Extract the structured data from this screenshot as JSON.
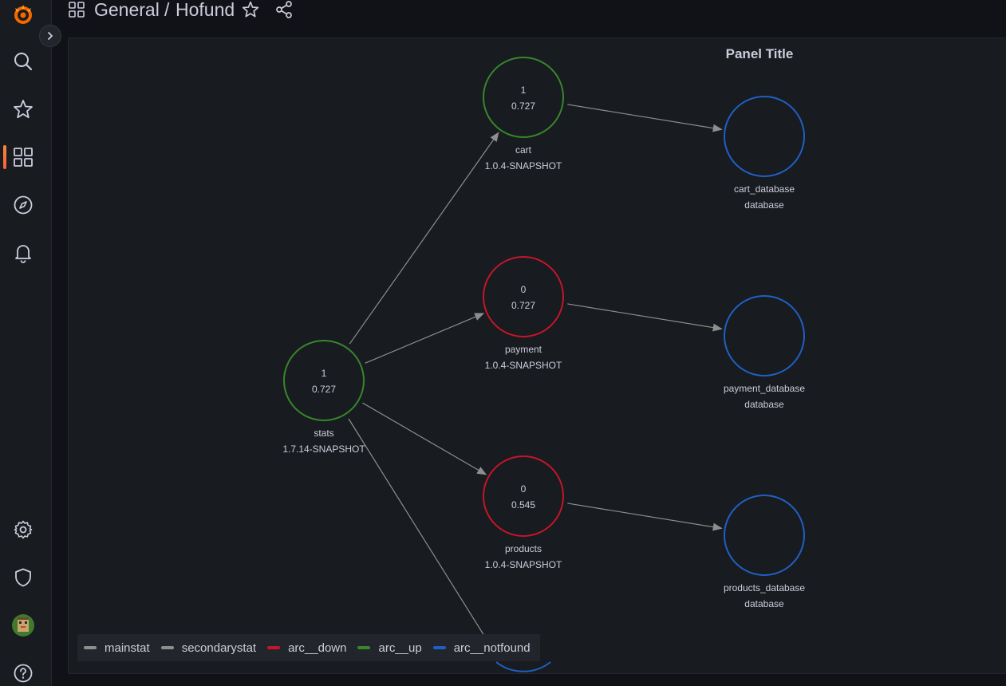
{
  "breadcrumb": {
    "folder": "General",
    "separator": "/",
    "dashboard": "Hofund"
  },
  "panel": {
    "title": "Panel Title"
  },
  "graph": {
    "nodes": [
      {
        "id": "stats",
        "mainstat": "1",
        "secondarystat": "0.727",
        "title": "stats",
        "subtitle": "1.7.14-SNAPSHOT",
        "status": "arc__up"
      },
      {
        "id": "cart",
        "mainstat": "1",
        "secondarystat": "0.727",
        "title": "cart",
        "subtitle": "1.0.4-SNAPSHOT",
        "status": "arc__up"
      },
      {
        "id": "payment",
        "mainstat": "0",
        "secondarystat": "0.727",
        "title": "payment",
        "subtitle": "1.0.4-SNAPSHOT",
        "status": "arc__down"
      },
      {
        "id": "products",
        "mainstat": "0",
        "secondarystat": "0.545",
        "title": "products",
        "subtitle": "1.0.4-SNAPSHOT",
        "status": "arc__down"
      },
      {
        "id": "cart_database",
        "mainstat": "",
        "secondarystat": "",
        "title": "cart_database",
        "subtitle": "database",
        "status": "arc__notfound"
      },
      {
        "id": "payment_database",
        "mainstat": "",
        "secondarystat": "",
        "title": "payment_database",
        "subtitle": "database",
        "status": "arc__notfound"
      },
      {
        "id": "products_database",
        "mainstat": "",
        "secondarystat": "",
        "title": "products_database",
        "subtitle": "database",
        "status": "arc__notfound"
      }
    ],
    "edges": [
      {
        "source": "stats",
        "target": "cart"
      },
      {
        "source": "stats",
        "target": "payment"
      },
      {
        "source": "stats",
        "target": "products"
      },
      {
        "source": "cart",
        "target": "cart_database"
      },
      {
        "source": "payment",
        "target": "payment_database"
      },
      {
        "source": "products",
        "target": "products_database"
      }
    ]
  },
  "legend": {
    "items": [
      {
        "label": "mainstat",
        "color": "#8e8e8e"
      },
      {
        "label": "secondarystat",
        "color": "#8e8e8e"
      },
      {
        "label": "arc__down",
        "color": "#c4162a"
      },
      {
        "label": "arc__up",
        "color": "#37872d"
      },
      {
        "label": "arc__notfound",
        "color": "#1f60c4"
      }
    ]
  },
  "colors": {
    "arc__up": "#37872d",
    "arc__down": "#c4162a",
    "arc__notfound": "#1f60c4",
    "edge": "#8e8e8e",
    "brand": "#f46800"
  },
  "icons": {
    "logo": "grafana-logo-icon",
    "search": "search-icon",
    "starred": "star-icon",
    "dashboards": "dashboards-grid-icon",
    "explore": "compass-icon",
    "alerting": "bell-icon",
    "config": "gear-icon",
    "admin": "shield-icon",
    "profile": "avatar",
    "help": "help-icon"
  }
}
